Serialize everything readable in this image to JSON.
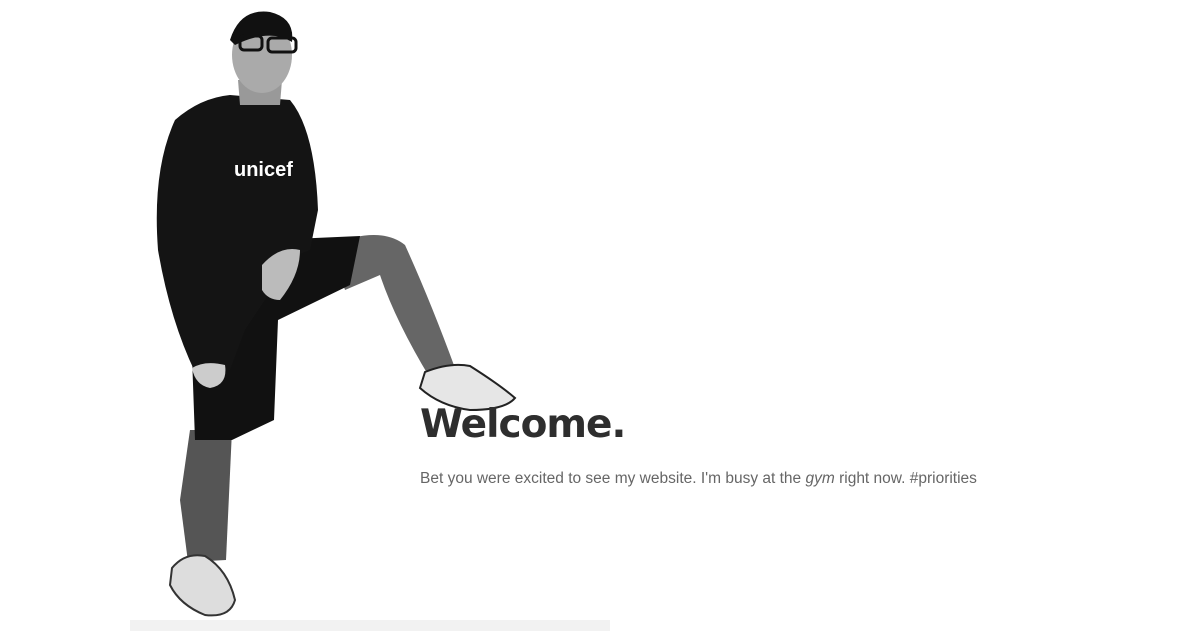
{
  "hero": {
    "title": "Welcome.",
    "tagline_before": "Bet you were excited to see my website. I'm busy at the ",
    "tagline_emphasis": "gym",
    "tagline_after": " right now. #priorities",
    "photo_logo_text": "unicef"
  },
  "colors": {
    "title": "#2e2e2e",
    "text": "#666666"
  }
}
